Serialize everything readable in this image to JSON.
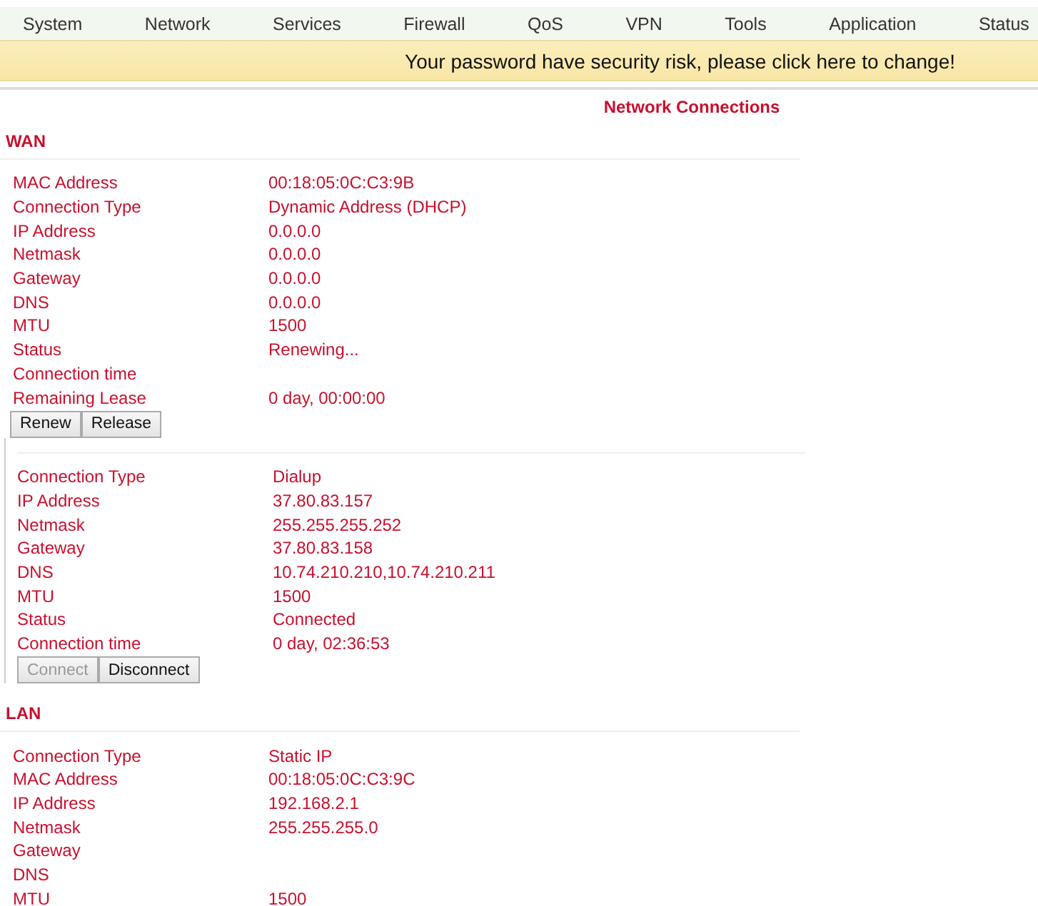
{
  "menu": [
    {
      "label": "System"
    },
    {
      "label": "Network"
    },
    {
      "label": "Services"
    },
    {
      "label": "Firewall"
    },
    {
      "label": "QoS"
    },
    {
      "label": "VPN"
    },
    {
      "label": "Tools"
    },
    {
      "label": "Application"
    },
    {
      "label": "Status"
    }
  ],
  "banner": {
    "text": "Your password have security risk, please click here to change!"
  },
  "page_title": "Network Connections",
  "sections": [
    {
      "title": "WAN",
      "rows": [
        [
          "MAC Address",
          "00:18:05:0C:C3:9B"
        ],
        [
          "Connection Type",
          "Dynamic Address (DHCP)"
        ],
        [
          "IP Address",
          "0.0.0.0"
        ],
        [
          "Netmask",
          "0.0.0.0"
        ],
        [
          "Gateway",
          "0.0.0.0"
        ],
        [
          "DNS",
          "0.0.0.0"
        ],
        [
          "MTU",
          "1500"
        ],
        [
          "Status",
          "Renewing..."
        ],
        [
          "Connection time",
          ""
        ],
        [
          "Remaining Lease",
          "0 day, 00:00:00"
        ]
      ],
      "buttons": [
        {
          "label": "Renew",
          "disabled": false
        },
        {
          "label": "Release",
          "disabled": false
        }
      ]
    },
    {
      "rows": [
        [
          "Connection Type",
          "Dialup"
        ],
        [
          "IP Address",
          "37.80.83.157"
        ],
        [
          "Netmask",
          "255.255.255.252"
        ],
        [
          "Gateway",
          "37.80.83.158"
        ],
        [
          "DNS",
          "10.74.210.210,10.74.210.211"
        ],
        [
          "MTU",
          "1500"
        ],
        [
          "Status",
          "Connected"
        ],
        [
          "Connection time",
          "0 day, 02:36:53"
        ]
      ],
      "buttons": [
        {
          "label": "Connect",
          "disabled": true
        },
        {
          "label": "Disconnect",
          "disabled": false
        }
      ]
    },
    {
      "title": "LAN",
      "rows": [
        [
          "Connection Type",
          "Static IP"
        ],
        [
          "MAC Address",
          "00:18:05:0C:C3:9C"
        ],
        [
          "IP Address",
          "192.168.2.1"
        ],
        [
          "Netmask",
          "255.255.255.0"
        ],
        [
          "Gateway",
          ""
        ],
        [
          "DNS",
          ""
        ],
        [
          "MTU",
          "1500"
        ]
      ]
    }
  ]
}
